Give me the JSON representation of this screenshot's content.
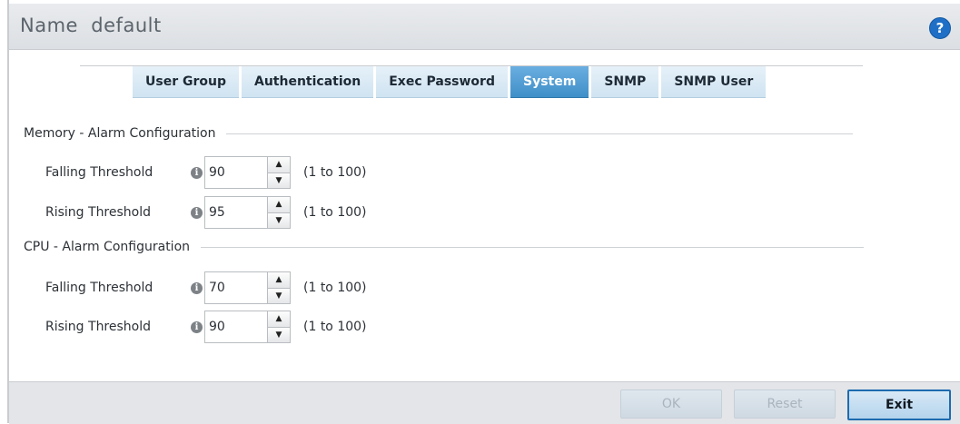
{
  "header": {
    "title": "Name  default",
    "help_icon": "?"
  },
  "tabs": [
    {
      "label": "User Group",
      "active": false
    },
    {
      "label": "Authentication",
      "active": false
    },
    {
      "label": "Exec Password",
      "active": false
    },
    {
      "label": "System",
      "active": true
    },
    {
      "label": "SNMP",
      "active": false
    },
    {
      "label": "SNMP User",
      "active": false
    }
  ],
  "memory": {
    "title": "Memory - Alarm Configuration",
    "falling": {
      "label": "Falling Threshold",
      "value": "90",
      "range": "(1 to 100)"
    },
    "rising": {
      "label": "Rising Threshold",
      "value": "95",
      "range": "(1 to 100)"
    }
  },
  "cpu": {
    "title": "CPU - Alarm Configuration",
    "falling": {
      "label": "Falling Threshold",
      "value": "70",
      "range": "(1 to 100)"
    },
    "rising": {
      "label": "Rising Threshold",
      "value": "90",
      "range": "(1 to 100)"
    }
  },
  "footer": {
    "ok": "OK",
    "reset": "Reset",
    "exit": "Exit"
  },
  "colors": {
    "accent": "#3f8fc8",
    "tab_bg": "#d9e9f5",
    "exit_border": "#1e6bb0"
  }
}
